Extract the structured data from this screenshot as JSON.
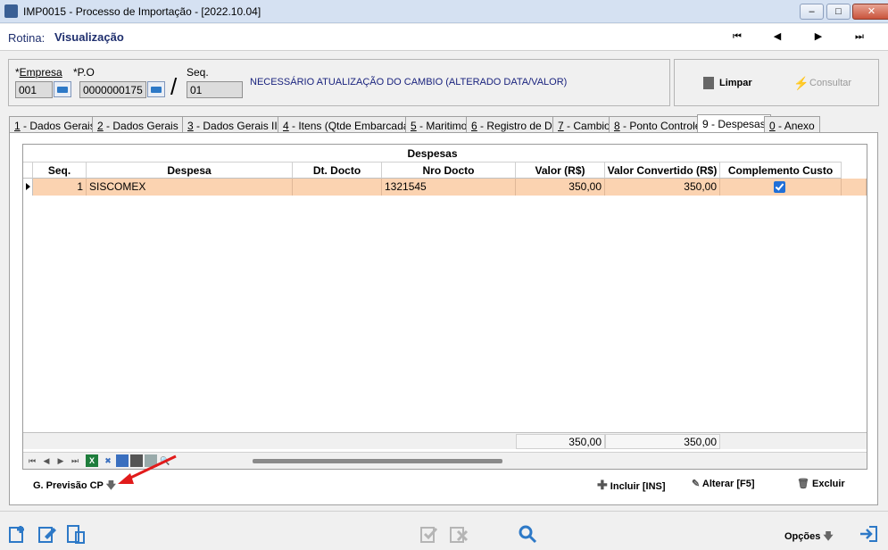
{
  "window": {
    "title": "IMP0015 - Processo de Importação - [2022.10.04]",
    "buttons": [
      "minimize",
      "maximize",
      "close"
    ]
  },
  "rotina": {
    "label": "Rotina:",
    "value": "Visualização"
  },
  "nav": [
    "first-icon",
    "prev-icon",
    "next-icon",
    "last-icon"
  ],
  "form": {
    "empresa": {
      "label": "Empresa",
      "value": "001"
    },
    "po": {
      "label": "P.O",
      "value": "0000000175"
    },
    "seq": {
      "label": "Seq.",
      "value": "01"
    },
    "message": "NECESSÁRIO ATUALIZAÇÃO DO CAMBIO (ALTERADO DATA/VALOR)",
    "limpar_label": "Limpar",
    "consultar_label": "Consultar"
  },
  "tabs": [
    {
      "key": "1",
      "label": " - Dados Gerais"
    },
    {
      "key": "2",
      "label": " - Dados Gerais II"
    },
    {
      "key": "3",
      "label": " - Dados Gerais III"
    },
    {
      "key": "4",
      "label": " - Itens (Qtde Embarcada)"
    },
    {
      "key": "5",
      "label": " - Maritimo"
    },
    {
      "key": "6",
      "label": " - Registro de DI"
    },
    {
      "key": "7",
      "label": " - Cambio"
    },
    {
      "key": "8",
      "label": " - Ponto Controle"
    },
    {
      "key": "9",
      "label": " - Despesas"
    },
    {
      "key": "0",
      "label": " - Anexo"
    }
  ],
  "grid": {
    "band": "Despesas",
    "columns": [
      "Seq.",
      "Despesa",
      "Dt. Docto",
      "Nro Docto",
      "Valor (R$)",
      "Valor Convertido (R$)",
      "Complemento Custo"
    ],
    "rows": [
      {
        "seq": "1",
        "despesa": "SISCOMEX",
        "dt_docto": "",
        "nro_docto": "1321545",
        "valor": "350,00",
        "valor_convertido": "350,00",
        "complemento_custo": true
      }
    ],
    "totals": {
      "valor": "350,00",
      "valor_convertido": "350,00"
    }
  },
  "actions": {
    "g_previsao": "G. Previsão CP",
    "incluir": "Incluir [INS]",
    "alterar": "Alterar [F5]",
    "excluir": "Excluir"
  },
  "bottom": {
    "opcoes": "Opções"
  },
  "colors": {
    "selected_row": "#fbd3b1",
    "title_text": "#1f2f6e",
    "message": "#1a237e"
  }
}
